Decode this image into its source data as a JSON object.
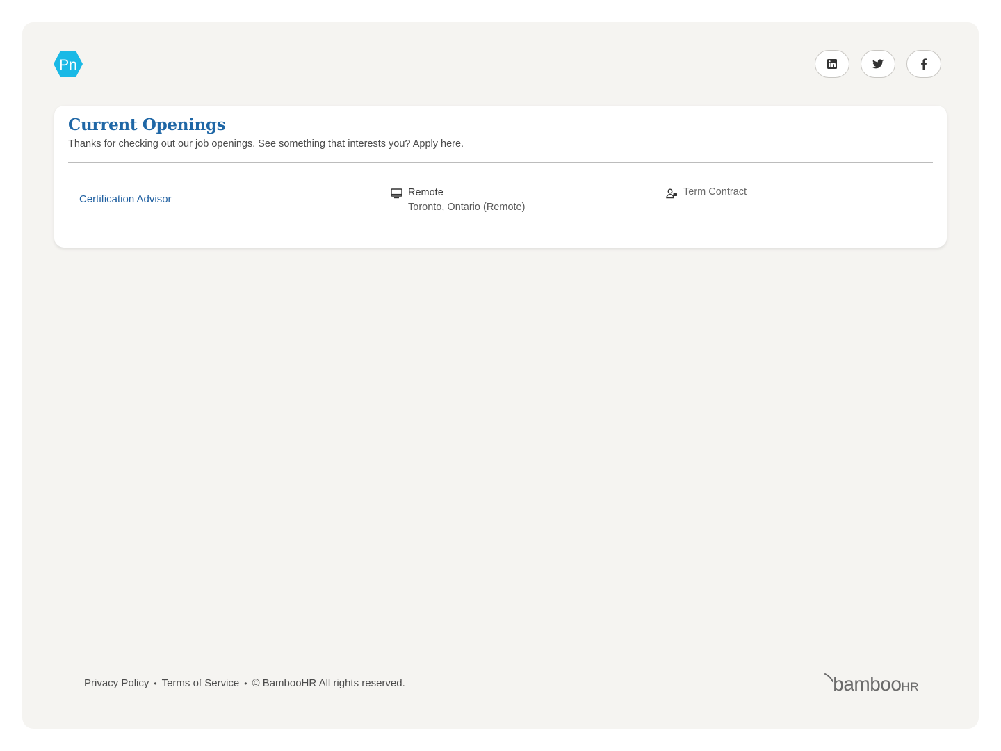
{
  "brand": {
    "logo_text": "Pn",
    "logo_color": "#1ab9e6"
  },
  "social": [
    {
      "name": "linkedin-icon"
    },
    {
      "name": "twitter-icon"
    },
    {
      "name": "facebook-icon"
    }
  ],
  "openings": {
    "title": "Current Openings",
    "subtitle": "Thanks for checking out our job openings. See something that interests you? Apply here.",
    "jobs": [
      {
        "title": "Certification Advisor",
        "location_type": "Remote",
        "location": "Toronto, Ontario (Remote)",
        "employment_type": "Term Contract"
      }
    ]
  },
  "footer": {
    "privacy": "Privacy Policy",
    "terms": "Terms of Service",
    "copyright": "© BambooHR All rights reserved.",
    "bamboo_word": "bamboo",
    "bamboo_hr": "HR"
  },
  "colors": {
    "accent": "#1f67a6",
    "background": "#f5f4f1"
  }
}
